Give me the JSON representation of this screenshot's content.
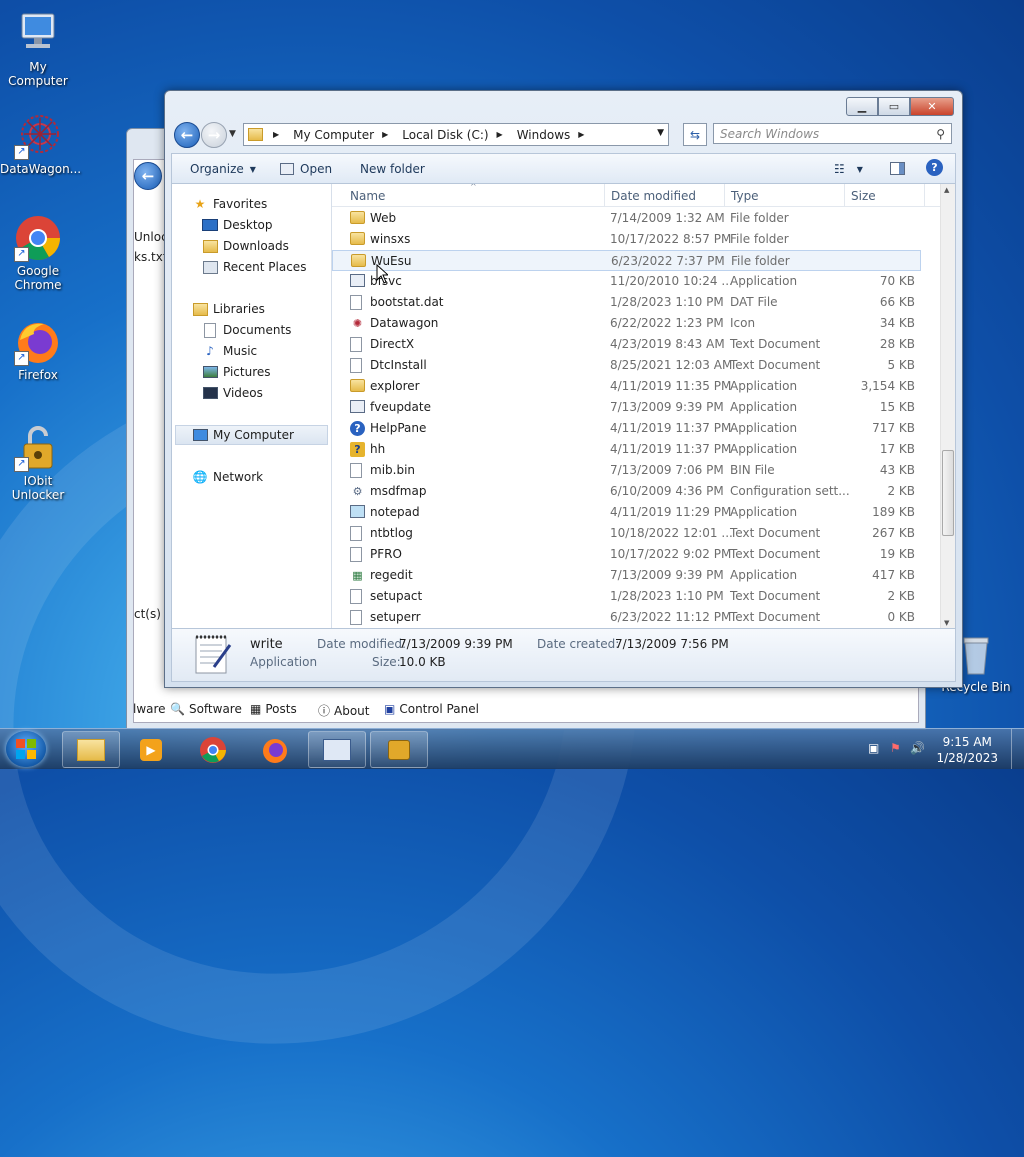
{
  "desktop": {
    "icons": [
      {
        "name": "my-computer",
        "label": "My Computer"
      },
      {
        "name": "datawagon",
        "label": "DataWagon..."
      },
      {
        "name": "google-chrome",
        "label": "Google Chrome"
      },
      {
        "name": "firefox",
        "label": "Firefox"
      },
      {
        "name": "iobit-unlocker",
        "label": "IObit Unlocker"
      },
      {
        "name": "recycle-bin",
        "label": "Recycle Bin"
      }
    ]
  },
  "bg_window": {
    "text1": "Unloc",
    "text2": "ks.txt",
    "text3": "ct(s) s",
    "quicklinks": [
      "lware",
      "Software",
      "Posts",
      "About",
      "Control Panel"
    ]
  },
  "explorer": {
    "breadcrumb": [
      "My Computer",
      "Local Disk (C:)",
      "Windows"
    ],
    "search_placeholder": "Search Windows",
    "toolbar": {
      "organize": "Organize",
      "open": "Open",
      "new_folder": "New folder"
    },
    "nav": {
      "favorites": "Favorites",
      "desktop": "Desktop",
      "downloads": "Downloads",
      "recent": "Recent Places",
      "libraries": "Libraries",
      "documents": "Documents",
      "music": "Music",
      "pictures": "Pictures",
      "videos": "Videos",
      "computer": "My Computer",
      "network": "Network"
    },
    "columns": {
      "name": "Name",
      "date": "Date modified",
      "type": "Type",
      "size": "Size"
    },
    "files": [
      {
        "name": "Web",
        "date": "7/14/2009 1:32 AM",
        "type": "File folder",
        "size": "",
        "icon": "folder"
      },
      {
        "name": "winsxs",
        "date": "10/17/2022 8:57 PM",
        "type": "File folder",
        "size": "",
        "icon": "folder"
      },
      {
        "name": "WuEsu",
        "date": "6/23/2022 7:37 PM",
        "type": "File folder",
        "size": "",
        "icon": "folder"
      },
      {
        "name": "bfsvc",
        "date": "11/20/2010 10:24 ...",
        "type": "Application",
        "size": "70 KB",
        "icon": "app"
      },
      {
        "name": "bootstat.dat",
        "date": "1/28/2023 1:10 PM",
        "type": "DAT File",
        "size": "66 KB",
        "icon": "doc"
      },
      {
        "name": "Datawagon",
        "date": "6/22/2022 1:23 PM",
        "type": "Icon",
        "size": "34 KB",
        "icon": "ico"
      },
      {
        "name": "DirectX",
        "date": "4/23/2019 8:43 AM",
        "type": "Text Document",
        "size": "28 KB",
        "icon": "doc"
      },
      {
        "name": "DtcInstall",
        "date": "8/25/2021 12:03 AM",
        "type": "Text Document",
        "size": "5 KB",
        "icon": "doc"
      },
      {
        "name": "explorer",
        "date": "4/11/2019 11:35 PM",
        "type": "Application",
        "size": "3,154 KB",
        "icon": "folderapp"
      },
      {
        "name": "fveupdate",
        "date": "7/13/2009 9:39 PM",
        "type": "Application",
        "size": "15 KB",
        "icon": "app"
      },
      {
        "name": "HelpPane",
        "date": "4/11/2019 11:37 PM",
        "type": "Application",
        "size": "717 KB",
        "icon": "help"
      },
      {
        "name": "hh",
        "date": "4/11/2019 11:37 PM",
        "type": "Application",
        "size": "17 KB",
        "icon": "hh"
      },
      {
        "name": "mib.bin",
        "date": "7/13/2009 7:06 PM",
        "type": "BIN File",
        "size": "43 KB",
        "icon": "doc"
      },
      {
        "name": "msdfmap",
        "date": "6/10/2009 4:36 PM",
        "type": "Configuration sett...",
        "size": "2 KB",
        "icon": "cfg"
      },
      {
        "name": "notepad",
        "date": "4/11/2019 11:29 PM",
        "type": "Application",
        "size": "189 KB",
        "icon": "notepad"
      },
      {
        "name": "ntbtlog",
        "date": "10/18/2022 12:01 ...",
        "type": "Text Document",
        "size": "267 KB",
        "icon": "doc"
      },
      {
        "name": "PFRO",
        "date": "10/17/2022 9:02 PM",
        "type": "Text Document",
        "size": "19 KB",
        "icon": "doc"
      },
      {
        "name": "regedit",
        "date": "7/13/2009 9:39 PM",
        "type": "Application",
        "size": "417 KB",
        "icon": "regedit"
      },
      {
        "name": "setupact",
        "date": "1/28/2023 1:10 PM",
        "type": "Text Document",
        "size": "2 KB",
        "icon": "doc"
      },
      {
        "name": "setuperr",
        "date": "6/23/2022 11:12 PM",
        "type": "Text Document",
        "size": "0 KB",
        "icon": "doc"
      }
    ],
    "details": {
      "name": "write",
      "type": "Application",
      "date_modified_label": "Date modified:",
      "date_modified": "7/13/2009 9:39 PM",
      "date_created_label": "Date created:",
      "date_created": "7/13/2009 7:56 PM",
      "size_label": "Size:",
      "size": "10.0 KB"
    }
  },
  "taskbar": {
    "time": "9:15 AM",
    "date": "1/28/2023"
  }
}
